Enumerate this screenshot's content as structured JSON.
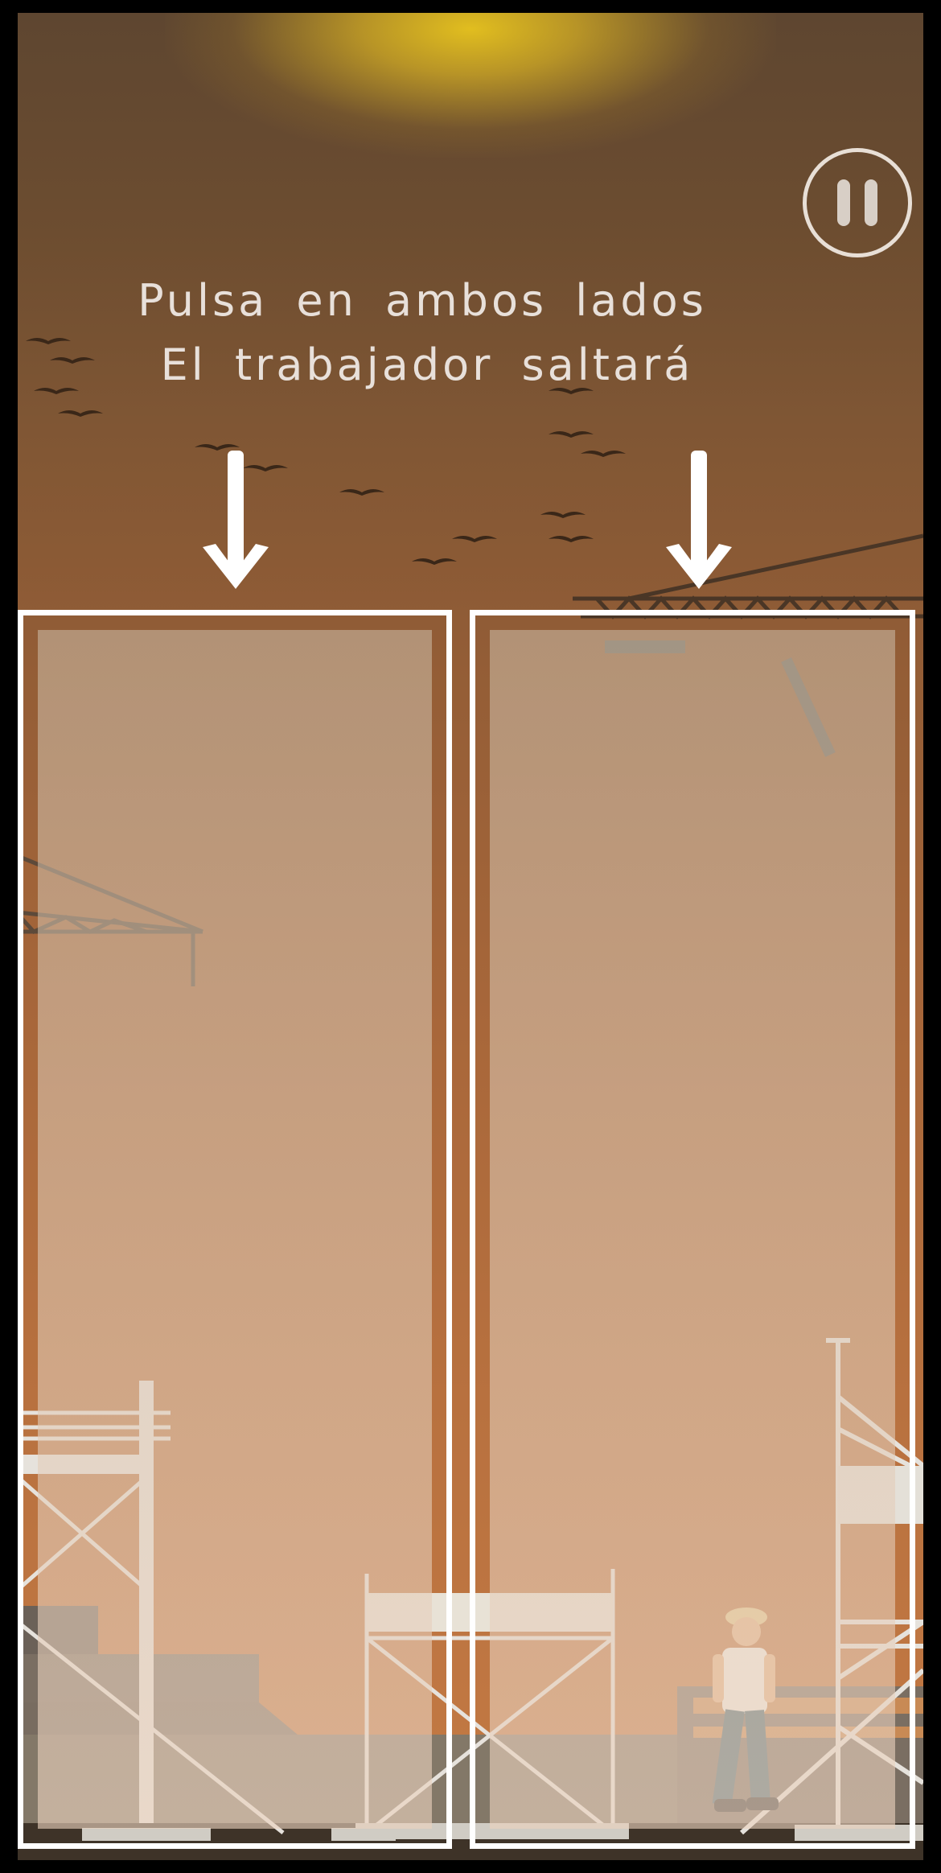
{
  "instructions": {
    "line1": "Pulsa en ambos lados",
    "line2": "El trabajador saltará"
  },
  "icons": {
    "pause": "pause-icon",
    "arrow": "arrow-down-icon",
    "worker": "worker-character"
  },
  "colors": {
    "sky_top": "#5e4630",
    "sky_bottom": "#c47a44",
    "sun": "#e8c41e",
    "zone_border": "#ffffff",
    "text": "#e8e0da"
  }
}
